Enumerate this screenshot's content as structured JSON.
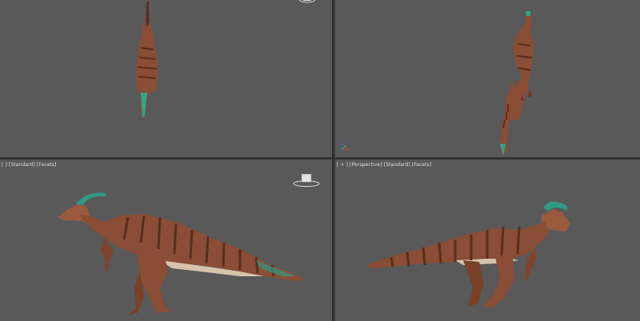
{
  "viewports": {
    "top_left": {
      "view": "top",
      "label": [
        "",
        "",
        ""
      ]
    },
    "top_right": {
      "view": "front",
      "label": [
        "",
        "",
        ""
      ]
    },
    "bottom_left": {
      "view": "left",
      "label": [
        "[",
        "] [Standard] [",
        "Facets]"
      ],
      "label_text": "[ ] [Standard] [Facets]"
    },
    "bottom_right": {
      "view": "perspective",
      "label_text": "[ + ] [Perspective] [Standard] [Facets]"
    }
  },
  "colors": {
    "viewport_bg": "#595959",
    "frame": "#2d2d2d",
    "dino_body": "#8a4d35",
    "dino_stripe": "#5e2e1c",
    "dino_belly": "#d9c7b0",
    "crest": "#3aa089"
  },
  "icons": [
    "viewcube-icon",
    "axis-gizmo-icon"
  ]
}
